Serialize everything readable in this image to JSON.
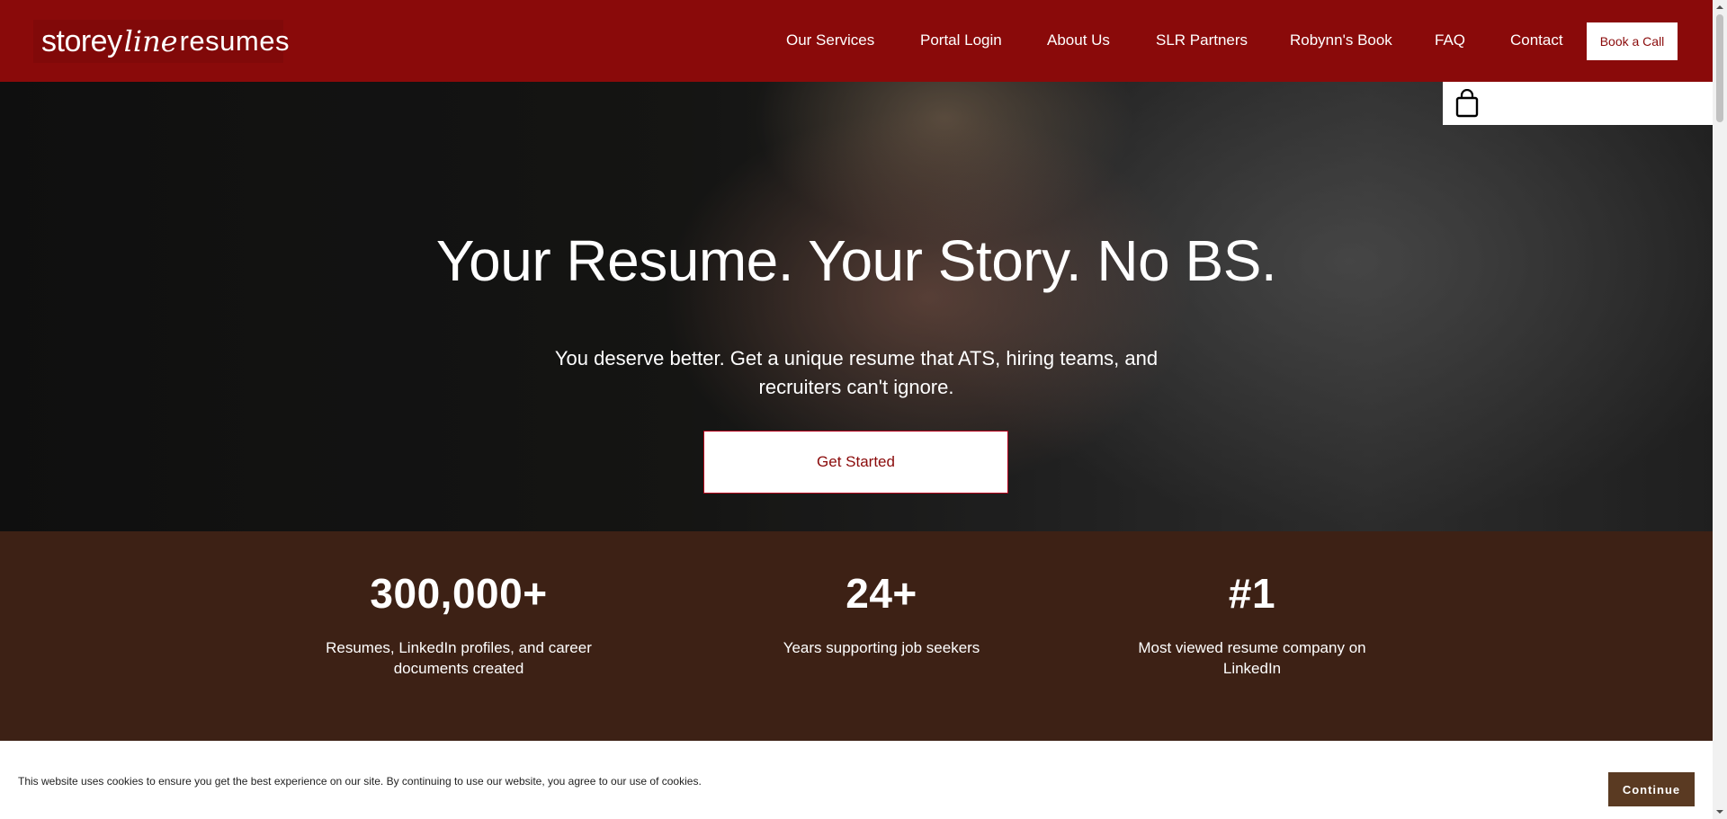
{
  "header": {
    "logo": {
      "part1": "storey",
      "part2": "line",
      "part3": "resumes"
    },
    "nav": [
      "Our Services",
      "Portal Login",
      "About Us",
      "SLR Partners",
      "Robynn's Book",
      "FAQ",
      "Contact"
    ],
    "book_call": "Book a Call"
  },
  "cart": {
    "icon": "shopping-bag-icon"
  },
  "hero": {
    "title": "Your Resume. Your Story. No BS.",
    "subtitle": "You deserve better. Get a unique resume that ATS, hiring teams, and recruiters can't ignore.",
    "cta": "Get Started"
  },
  "stats": [
    {
      "number": "300,000+",
      "label": "Resumes, LinkedIn profiles, and career documents created"
    },
    {
      "number": "24+",
      "label": "Years supporting job seekers"
    },
    {
      "number": "#1",
      "label": "Most viewed resume company on LinkedIn"
    }
  ],
  "cookie": {
    "text": "This website uses cookies to ensure you get the best experience on our site. By continuing to use our website, you agree to our use of cookies.",
    "button": "Continue"
  },
  "colors": {
    "header_bg": "#8a0a0a",
    "stats_bg": "#3d2115",
    "cookie_button_bg": "#5a3a22"
  }
}
